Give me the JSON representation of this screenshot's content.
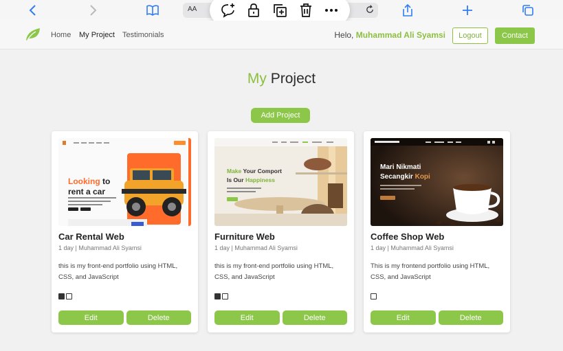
{
  "browser": {
    "text_size_label": "AA",
    "icons": [
      "back-icon",
      "forward-icon",
      "bookmarks-icon",
      "reload-icon",
      "share-icon",
      "new-tab-icon",
      "tabs-icon"
    ],
    "popup_icons": [
      "comment-add-icon",
      "lock-icon",
      "duplicate-icon",
      "trash-icon",
      "more-icon"
    ]
  },
  "nav": {
    "links": [
      "Home",
      "My Project",
      "Testimonials"
    ],
    "active": "My Project",
    "greeting": "Helo,",
    "user_name": "Muhammad Ali Syamsi",
    "logout_label": "Logout",
    "contact_label": "Contact"
  },
  "page": {
    "title_highlight": "My",
    "title_rest": "Project",
    "add_label": "Add Project"
  },
  "projects": [
    {
      "title": "Car Rental Web",
      "meta": "1 day | Muhammad Ali Syamsi",
      "description": "this is my front-end portfolio using HTML, CSS, and JavaScript",
      "tech_icons": [
        "js-icon",
        "css-icon"
      ],
      "thumb": {
        "headline_a": "Looking",
        "headline_b": "to",
        "headline_c": "rent a car"
      },
      "edit_label": "Edit",
      "delete_label": "Delete"
    },
    {
      "title": "Furniture Web",
      "meta": "1 day | Muhammad Ali Syamsi",
      "description": "this is my front-end portfolio using HTML, CSS, and JavaScript",
      "tech_icons": [
        "js-icon",
        "css-icon"
      ],
      "thumb": {
        "headline_a": "Make",
        "headline_b": "Your Comport",
        "headline_c": "Is Our",
        "headline_d": "Happiness"
      },
      "edit_label": "Edit",
      "delete_label": "Delete"
    },
    {
      "title": "Coffee Shop Web",
      "meta": "1 day | Muhammad Ali Syamsi",
      "description": "This is my frontend portfolio using HTML, CSS, and JavaScript",
      "tech_icons": [
        "css-icon"
      ],
      "thumb": {
        "headline_a": "Mari Nikmati",
        "headline_b": "Secangkir",
        "headline_c": "Kopi"
      },
      "edit_label": "Edit",
      "delete_label": "Delete"
    }
  ],
  "colors": {
    "accent": "#8cc74a",
    "accent_text": "#8cbf3f",
    "link_blue": "#2f7cf6"
  }
}
